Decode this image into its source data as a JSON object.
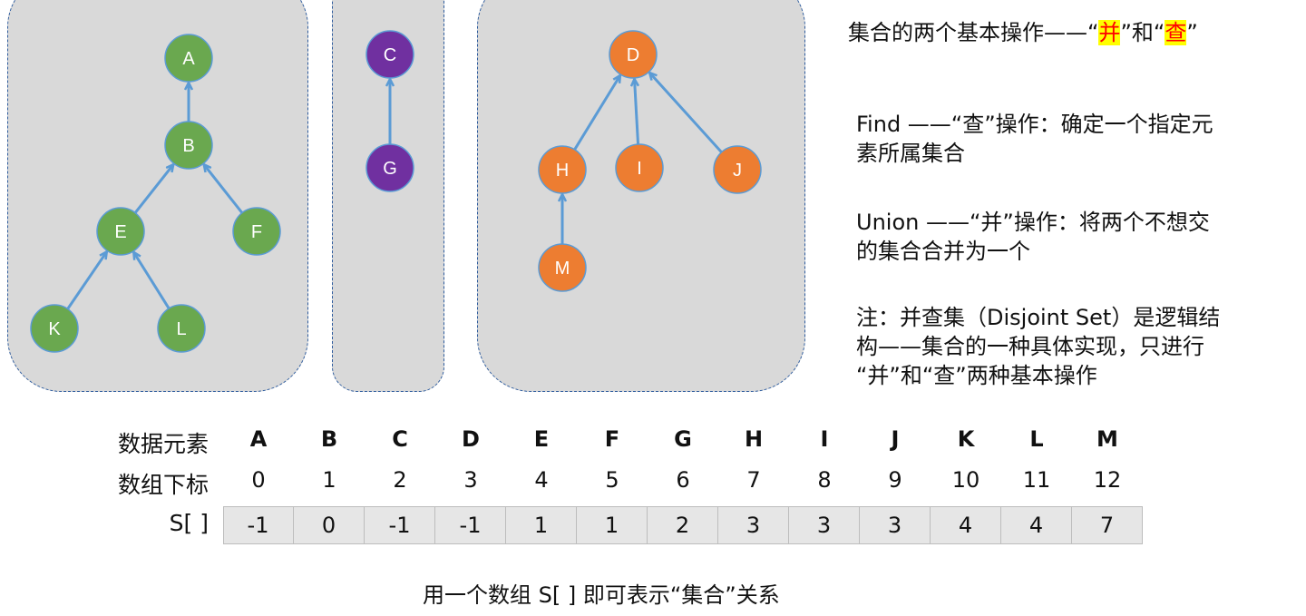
{
  "colors": {
    "green": "#6aa84f",
    "purple": "#7030a0",
    "orange": "#ed7d31",
    "edge": "#5b9bd5",
    "panel": "#d9d9d9",
    "panel_border": "#2e5c9e",
    "highlight_bg": "#ffff00",
    "highlight_fg": "#ff0000"
  },
  "trees": [
    {
      "color": "green",
      "nodes": [
        "A",
        "B",
        "E",
        "F",
        "K",
        "L"
      ],
      "edges": [
        [
          "B",
          "A"
        ],
        [
          "E",
          "B"
        ],
        [
          "F",
          "B"
        ],
        [
          "K",
          "E"
        ],
        [
          "L",
          "E"
        ]
      ]
    },
    {
      "color": "purple",
      "nodes": [
        "C",
        "G"
      ],
      "edges": [
        [
          "G",
          "C"
        ]
      ]
    },
    {
      "color": "orange",
      "nodes": [
        "D",
        "H",
        "I",
        "J",
        "M"
      ],
      "edges": [
        [
          "H",
          "D"
        ],
        [
          "I",
          "D"
        ],
        [
          "J",
          "D"
        ],
        [
          "M",
          "H"
        ]
      ]
    }
  ],
  "text": {
    "title_pre": "集合的两个基本操作——“",
    "title_union": "并",
    "title_mid": "”和“",
    "title_find": "查",
    "title_post": "”",
    "find_line1": "Find ——“查”操作：确定一个指定元",
    "find_line2": "素所属集合",
    "union_line1": "Union ——“并”操作：将两个不想交",
    "union_line2": "的集合合并为一个",
    "note_line1": "注：并查集（Disjoint Set）是逻辑结",
    "note_line2": "构——集合的一种具体实现，只进行",
    "note_line3": "“并”和“查”两种基本操作",
    "caption": "用一个数组 S[ ] 即可表示“集合”关系"
  },
  "table": {
    "label_elements": "数据元素",
    "label_index": "数组下标",
    "label_s": "S[ ]",
    "elements": [
      "A",
      "B",
      "C",
      "D",
      "E",
      "F",
      "G",
      "H",
      "I",
      "J",
      "K",
      "L",
      "M"
    ],
    "indices": [
      "0",
      "1",
      "2",
      "3",
      "4",
      "5",
      "6",
      "7",
      "8",
      "9",
      "10",
      "11",
      "12"
    ],
    "s_values": [
      "-1",
      "0",
      "-1",
      "-1",
      "1",
      "1",
      "2",
      "3",
      "3",
      "3",
      "4",
      "4",
      "7"
    ]
  }
}
